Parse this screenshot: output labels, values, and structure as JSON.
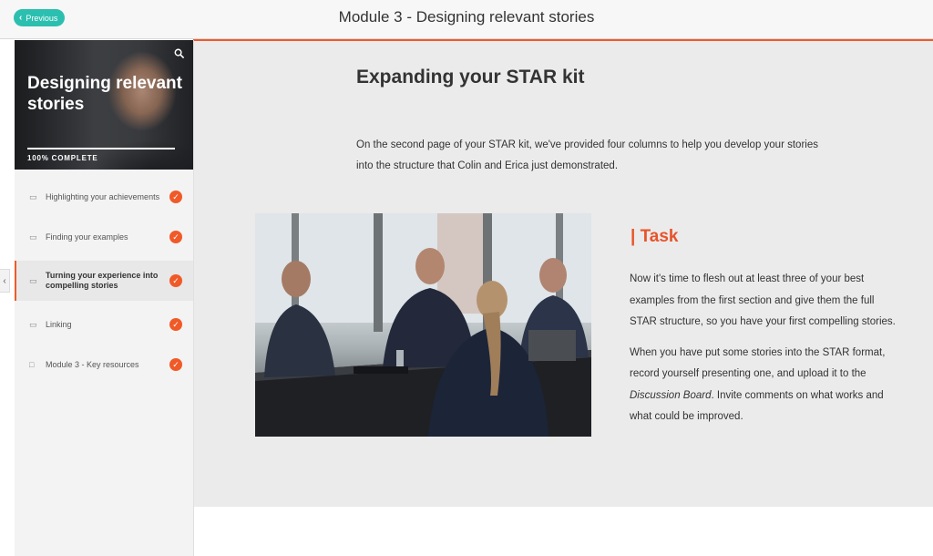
{
  "topbar": {
    "previous_label": "Previous",
    "module_title": "Module 3 - Designing relevant stories"
  },
  "sidebar": {
    "hero_title": "Designing relevant stories",
    "progress": 1.0,
    "complete_text": "100% COMPLETE",
    "items": [
      {
        "label": "Highlighting your achievements",
        "icon": "video-icon",
        "completed": true
      },
      {
        "label": "Finding your examples",
        "icon": "video-icon",
        "completed": true
      },
      {
        "label": "Turning your experience into compelling stories",
        "icon": "video-icon",
        "completed": true,
        "active": true
      },
      {
        "label": "Linking",
        "icon": "video-icon",
        "completed": true
      },
      {
        "label": "Module 3 - Key resources",
        "icon": "question-icon",
        "completed": true
      }
    ]
  },
  "content": {
    "title": "Expanding your STAR kit",
    "intro": "On the second page of your STAR kit, we've provided four columns to help you develop your stories into the structure that Colin and Erica just demonstrated.",
    "task_heading": "| Task",
    "task_p1": "Now it's time to flesh out at least three of your best examples from the first section and give them the full STAR structure, so you have your first compelling stories.",
    "task_p2_before": "When you have put some stories into the STAR format, record yourself presenting one, and upload it to the ",
    "task_p2_em": "Discussion Board",
    "task_p2_after": ". Invite comments on what works and what could be improved."
  },
  "colors": {
    "accent": "#f05a28",
    "teal": "#2bbfb0",
    "main_bg": "#ebebeb"
  }
}
